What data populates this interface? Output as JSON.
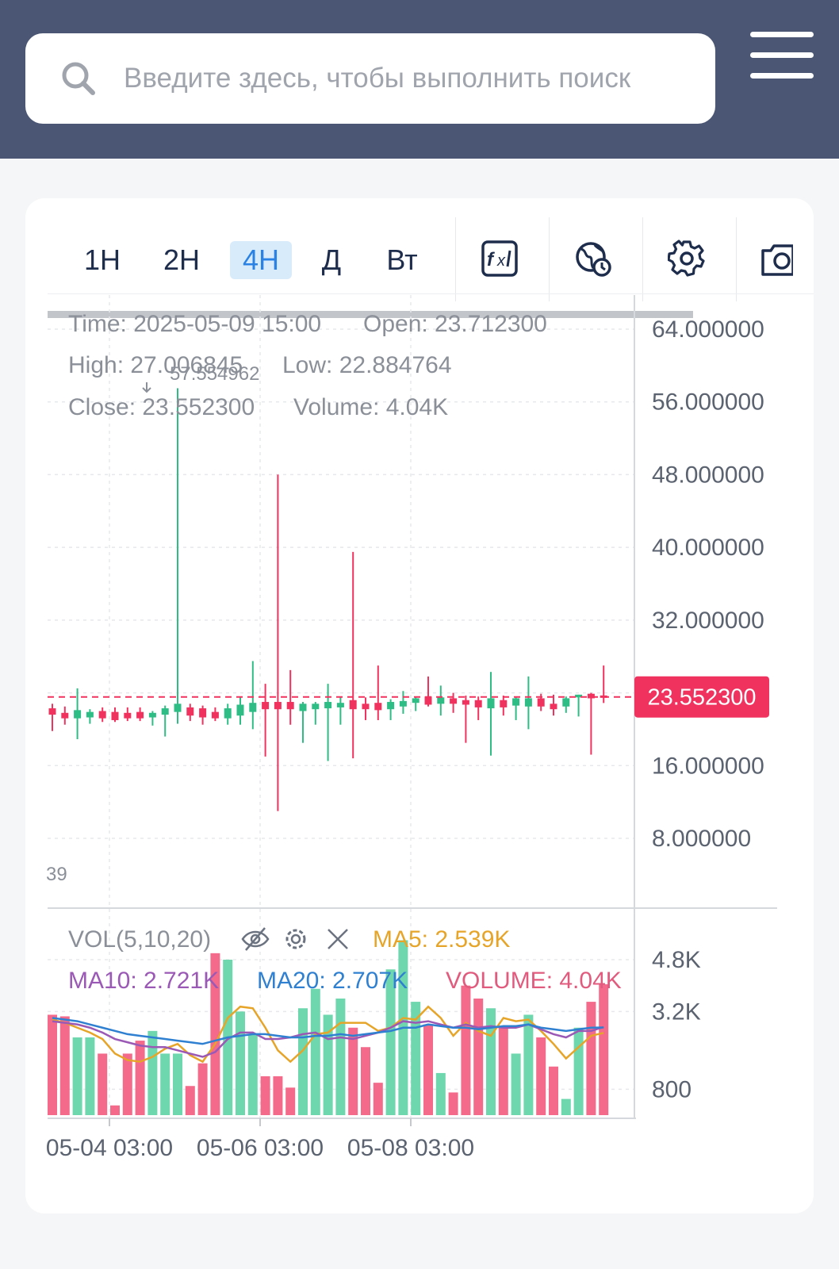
{
  "search": {
    "placeholder": "Введите здесь, чтобы выполнить поиск"
  },
  "toolbar": {
    "timeframes": [
      "1H",
      "2H",
      "4H",
      "Д",
      "Вт"
    ],
    "active_timeframe": "4H",
    "tools": [
      "indicator-fx-icon",
      "timezone-globe-icon",
      "settings-gear-icon",
      "camera-icon"
    ]
  },
  "ohlc": {
    "time": "Time: 2025-05-09 15:00",
    "open": "Open: 23.712300",
    "high": "High: 27.006845",
    "low": "Low: 22.884764",
    "close": "Close: 23.552300",
    "volume": "Volume: 4.04K"
  },
  "price_axis_labels": [
    "64.000000",
    "56.000000",
    "48.000000",
    "40.000000",
    "32.000000",
    "16.000000",
    "8.000000"
  ],
  "current_price": "23.552300",
  "max_mark": "57.554962",
  "cut_label": "39",
  "volume_panel": {
    "title": "VOL(5,10,20)",
    "ma5": "MA5: 2.539K",
    "ma10": "MA10: 2.721K",
    "ma20": "MA20: 2.707K",
    "volume": "VOLUME: 4.04K",
    "axis_labels": [
      "4.8K",
      "3.2K",
      "800"
    ]
  },
  "time_axis_labels": [
    "05-04 03:00",
    "05-06 03:00",
    "05-08 03:00"
  ],
  "colors": {
    "up": "#2ebd85",
    "down": "#f0325f",
    "ma5": "#e6a529",
    "ma10": "#9b59b6",
    "ma20": "#2f80d1",
    "header": "#4a5673"
  },
  "chart_data": {
    "type": "candlestick",
    "price_ylim": [
      0,
      70
    ],
    "volume_ylim": [
      0,
      6000
    ],
    "candles": [
      {
        "o": 22.3,
        "h": 22.8,
        "l": 19.8,
        "c": 21.6
      },
      {
        "o": 21.8,
        "h": 22.5,
        "l": 20.5,
        "c": 21.2
      },
      {
        "o": 21.2,
        "h": 24.5,
        "l": 18.9,
        "c": 22.1
      },
      {
        "o": 21.3,
        "h": 22.2,
        "l": 20.6,
        "c": 21.9
      },
      {
        "o": 22.0,
        "h": 22.4,
        "l": 20.8,
        "c": 21.2
      },
      {
        "o": 21.9,
        "h": 22.4,
        "l": 20.8,
        "c": 21.0
      },
      {
        "o": 21.8,
        "h": 22.4,
        "l": 20.9,
        "c": 21.2
      },
      {
        "o": 21.9,
        "h": 22.4,
        "l": 20.9,
        "c": 21.2
      },
      {
        "o": 21.3,
        "h": 22.0,
        "l": 20.4,
        "c": 21.8
      },
      {
        "o": 21.6,
        "h": 22.6,
        "l": 19.2,
        "c": 22.3
      },
      {
        "o": 21.9,
        "h": 57.5,
        "l": 20.6,
        "c": 22.8
      },
      {
        "o": 22.4,
        "h": 22.8,
        "l": 20.9,
        "c": 21.5
      },
      {
        "o": 22.3,
        "h": 22.6,
        "l": 20.5,
        "c": 21.3
      },
      {
        "o": 21.9,
        "h": 22.4,
        "l": 20.9,
        "c": 21.2
      },
      {
        "o": 21.2,
        "h": 22.8,
        "l": 20.5,
        "c": 22.3
      },
      {
        "o": 21.5,
        "h": 23.5,
        "l": 20.5,
        "c": 22.7
      },
      {
        "o": 21.9,
        "h": 27.5,
        "l": 20.0,
        "c": 22.9
      },
      {
        "o": 23.0,
        "h": 25.0,
        "l": 17.0,
        "c": 22.2
      },
      {
        "o": 23.0,
        "h": 48.0,
        "l": 11.0,
        "c": 22.2
      },
      {
        "o": 23.0,
        "h": 26.5,
        "l": 20.5,
        "c": 22.2
      },
      {
        "o": 22.0,
        "h": 23.0,
        "l": 18.5,
        "c": 22.8
      },
      {
        "o": 22.2,
        "h": 23.0,
        "l": 20.5,
        "c": 22.8
      },
      {
        "o": 22.3,
        "h": 25.0,
        "l": 16.5,
        "c": 23.0
      },
      {
        "o": 22.4,
        "h": 23.5,
        "l": 20.5,
        "c": 22.9
      },
      {
        "o": 23.2,
        "h": 39.5,
        "l": 16.8,
        "c": 22.2
      },
      {
        "o": 22.8,
        "h": 23.5,
        "l": 21.0,
        "c": 22.2
      },
      {
        "o": 22.9,
        "h": 27.0,
        "l": 21.0,
        "c": 22.1
      },
      {
        "o": 22.2,
        "h": 23.3,
        "l": 21.0,
        "c": 23.0
      },
      {
        "o": 22.5,
        "h": 24.2,
        "l": 21.7,
        "c": 23.1
      },
      {
        "o": 22.9,
        "h": 23.6,
        "l": 22.0,
        "c": 23.4
      },
      {
        "o": 23.6,
        "h": 25.8,
        "l": 22.5,
        "c": 22.7
      },
      {
        "o": 22.8,
        "h": 24.8,
        "l": 21.5,
        "c": 23.5
      },
      {
        "o": 23.4,
        "h": 24.0,
        "l": 21.8,
        "c": 22.8
      },
      {
        "o": 23.2,
        "h": 23.7,
        "l": 18.5,
        "c": 22.7
      },
      {
        "o": 23.2,
        "h": 23.6,
        "l": 21.0,
        "c": 22.4
      },
      {
        "o": 22.3,
        "h": 26.3,
        "l": 17.1,
        "c": 23.4
      },
      {
        "o": 23.2,
        "h": 23.7,
        "l": 21.5,
        "c": 22.4
      },
      {
        "o": 22.6,
        "h": 23.6,
        "l": 21.0,
        "c": 23.4
      },
      {
        "o": 22.5,
        "h": 25.8,
        "l": 20.0,
        "c": 23.4
      },
      {
        "o": 23.4,
        "h": 23.9,
        "l": 22.0,
        "c": 22.5
      },
      {
        "o": 22.8,
        "h": 23.8,
        "l": 21.5,
        "c": 22.2
      },
      {
        "o": 22.5,
        "h": 23.6,
        "l": 21.8,
        "c": 23.4
      },
      {
        "o": 23.5,
        "h": 23.8,
        "l": 21.4,
        "c": 23.8
      },
      {
        "o": 23.9,
        "h": 24.0,
        "l": 17.2,
        "c": 23.4
      },
      {
        "o": 23.7123,
        "h": 27.006845,
        "l": 22.884764,
        "c": 23.5523
      }
    ],
    "volume": [
      3100,
      3050,
      2400,
      2400,
      1900,
      300,
      1900,
      2300,
      2600,
      1900,
      1900,
      900,
      1600,
      5000,
      4800,
      3200,
      2500,
      1200,
      1200,
      850,
      3300,
      3900,
      3100,
      3600,
      2700,
      2100,
      1000,
      4500,
      5400,
      3500,
      2800,
      1300,
      700,
      4000,
      3600,
      3300,
      2700,
      1900,
      3100,
      2400,
      1500,
      500,
      2700,
      3500,
      4040
    ],
    "ma5": [
      2950,
      2850,
      2700,
      2550,
      2350,
      1900,
      1700,
      1650,
      1800,
      2050,
      2200,
      1850,
      1650,
      2200,
      3000,
      3350,
      3300,
      2700,
      2000,
      1650,
      2000,
      2500,
      2550,
      2850,
      2850,
      2850,
      2600,
      2700,
      3000,
      2950,
      3350,
      3000,
      2450,
      2850,
      2600,
      2450,
      3000,
      2900,
      2950,
      2600,
      2200,
      1750,
      2100,
      2450,
      2539
    ],
    "ma10": [
      2900,
      2850,
      2800,
      2700,
      2550,
      2350,
      2250,
      2150,
      2100,
      2100,
      2000,
      1900,
      1800,
      1950,
      2350,
      2550,
      2550,
      2350,
      2350,
      2400,
      2500,
      2550,
      2350,
      2400,
      2350,
      2450,
      2550,
      2700,
      2900,
      2850,
      2900,
      2800,
      2700,
      2800,
      2700,
      2750,
      2700,
      2700,
      2800,
      2650,
      2500,
      2400,
      2600,
      2600,
      2721
    ],
    "ma20": [
      3000,
      2950,
      2900,
      2800,
      2700,
      2600,
      2500,
      2450,
      2400,
      2350,
      2300,
      2250,
      2200,
      2300,
      2400,
      2450,
      2500,
      2500,
      2450,
      2400,
      2400,
      2450,
      2450,
      2500,
      2450,
      2500,
      2550,
      2600,
      2700,
      2700,
      2800,
      2750,
      2700,
      2700,
      2650,
      2700,
      2750,
      2750,
      2800,
      2700,
      2650,
      2600,
      2650,
      2700,
      2707
    ]
  }
}
